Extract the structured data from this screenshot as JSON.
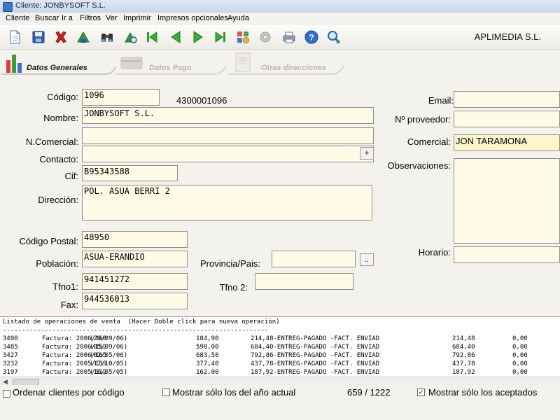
{
  "window": {
    "title": "Cliente: JONBYSOFT S.L."
  },
  "menu": [
    "Cliente",
    "Buscar",
    "Ir a",
    "Filtros",
    "Ver",
    "Imprimir",
    "Impresos opcionales",
    "Ayuda"
  ],
  "toolbar": {
    "company": "APLIMEDIA S.L.",
    "icons": [
      "new-document-icon",
      "save-icon",
      "delete-icon",
      "go-back-icon",
      "binoculars-icon",
      "search-record-icon",
      "first-record-icon",
      "previous-record-icon",
      "next-record-icon",
      "last-record-icon",
      "settings-icon",
      "tools-icon",
      "print-icon",
      "help-icon",
      "search-zoom-icon"
    ]
  },
  "tabs": [
    {
      "label": "Datos Generales",
      "active": true
    },
    {
      "label": "Datos Pago",
      "active": false
    },
    {
      "label": "Otras direcciones",
      "active": false
    }
  ],
  "form": {
    "codigo": {
      "label": "Código:",
      "value": "1096",
      "extra": "4300001096"
    },
    "nombre": {
      "label": "Nombre:",
      "value": "JONBYSOFT S.L."
    },
    "ncomercial": {
      "label": "N.Comercial:",
      "value": ""
    },
    "contacto": {
      "label": "Contacto:",
      "value": "",
      "button": "+"
    },
    "cif": {
      "label": "Cif:",
      "value": "B95343588"
    },
    "direccion": {
      "label": "Dirección:",
      "value": "POL. ASUA BERRI 2"
    },
    "codigo_postal": {
      "label": "Código Postal:",
      "value": "48950"
    },
    "poblacion": {
      "label": "Población:",
      "value": "ASUA-ERANDIO"
    },
    "provincia": {
      "label": "Provincia/Pais:",
      "value": "",
      "button": ".."
    },
    "tfno1": {
      "label": "Tfno1:",
      "value": "941451272"
    },
    "tfno2": {
      "label": "Tfno 2:",
      "value": ""
    },
    "fax": {
      "label": "Fax:",
      "value": "944536013"
    },
    "email": {
      "label": "Email:",
      "value": ""
    },
    "nproveedor": {
      "label": "Nº proveedor:",
      "value": ""
    },
    "comercial": {
      "label": "Comercial:",
      "value": "JON TARAMONA"
    },
    "observaciones": {
      "label": "Observaciones:",
      "value": ""
    },
    "horario": {
      "label": "Horario:",
      "value": ""
    }
  },
  "listing": {
    "header": "Listado de operaciones de venta  (Hacer Doble click para nueva operación)",
    "separator": "----------------------------------------------------------------------",
    "rows": [
      {
        "num": "3498",
        "doc": "Factura: 2006/160",
        "date": "(29/09/06)",
        "amount": "184,90",
        "status": "214,48-ENTREG-PAGADO -FACT. ENVIAD",
        "total": "214,48",
        "extra": "0,00"
      },
      {
        "num": "3485",
        "doc": "Factura: 2006/152",
        "date": "(05/09/06)",
        "amount": "590,00",
        "status": "684,40-ENTREG-PAGADO -FACT. ENVIAD",
        "total": "684,40",
        "extra": "0,00"
      },
      {
        "num": "3427",
        "doc": "Factura: 2006/105",
        "date": "(02/05/06)",
        "amount": "683,50",
        "status": "792,86-ENTREG-PAGADO -FACT. ENVIAD",
        "total": "792,86",
        "extra": "0,00"
      },
      {
        "num": "3232",
        "doc": "Factura: 2005/135",
        "date": "(17/10/05)",
        "amount": "377,40",
        "status": "437,78-ENTREG-PAGADO -FACT. ENVIAD",
        "total": "437,78",
        "extra": "0,00"
      },
      {
        "num": "3197",
        "doc": "Factura: 2005/112",
        "date": "(16/05/05)",
        "amount": "162,00",
        "status": "187,92-ENTREG-PAGADO -FACT. ENVIAD",
        "total": "187,92",
        "extra": "0,00"
      }
    ]
  },
  "status": {
    "order_by_code": {
      "label": "Ordenar clientes por código",
      "checked": false
    },
    "current_year": {
      "label": "Mostrar sólo los del año actual",
      "checked": false
    },
    "counter": "659 / 1222",
    "accepted_only": {
      "label": "Mostrar sólo los aceptados",
      "checked": true
    }
  }
}
